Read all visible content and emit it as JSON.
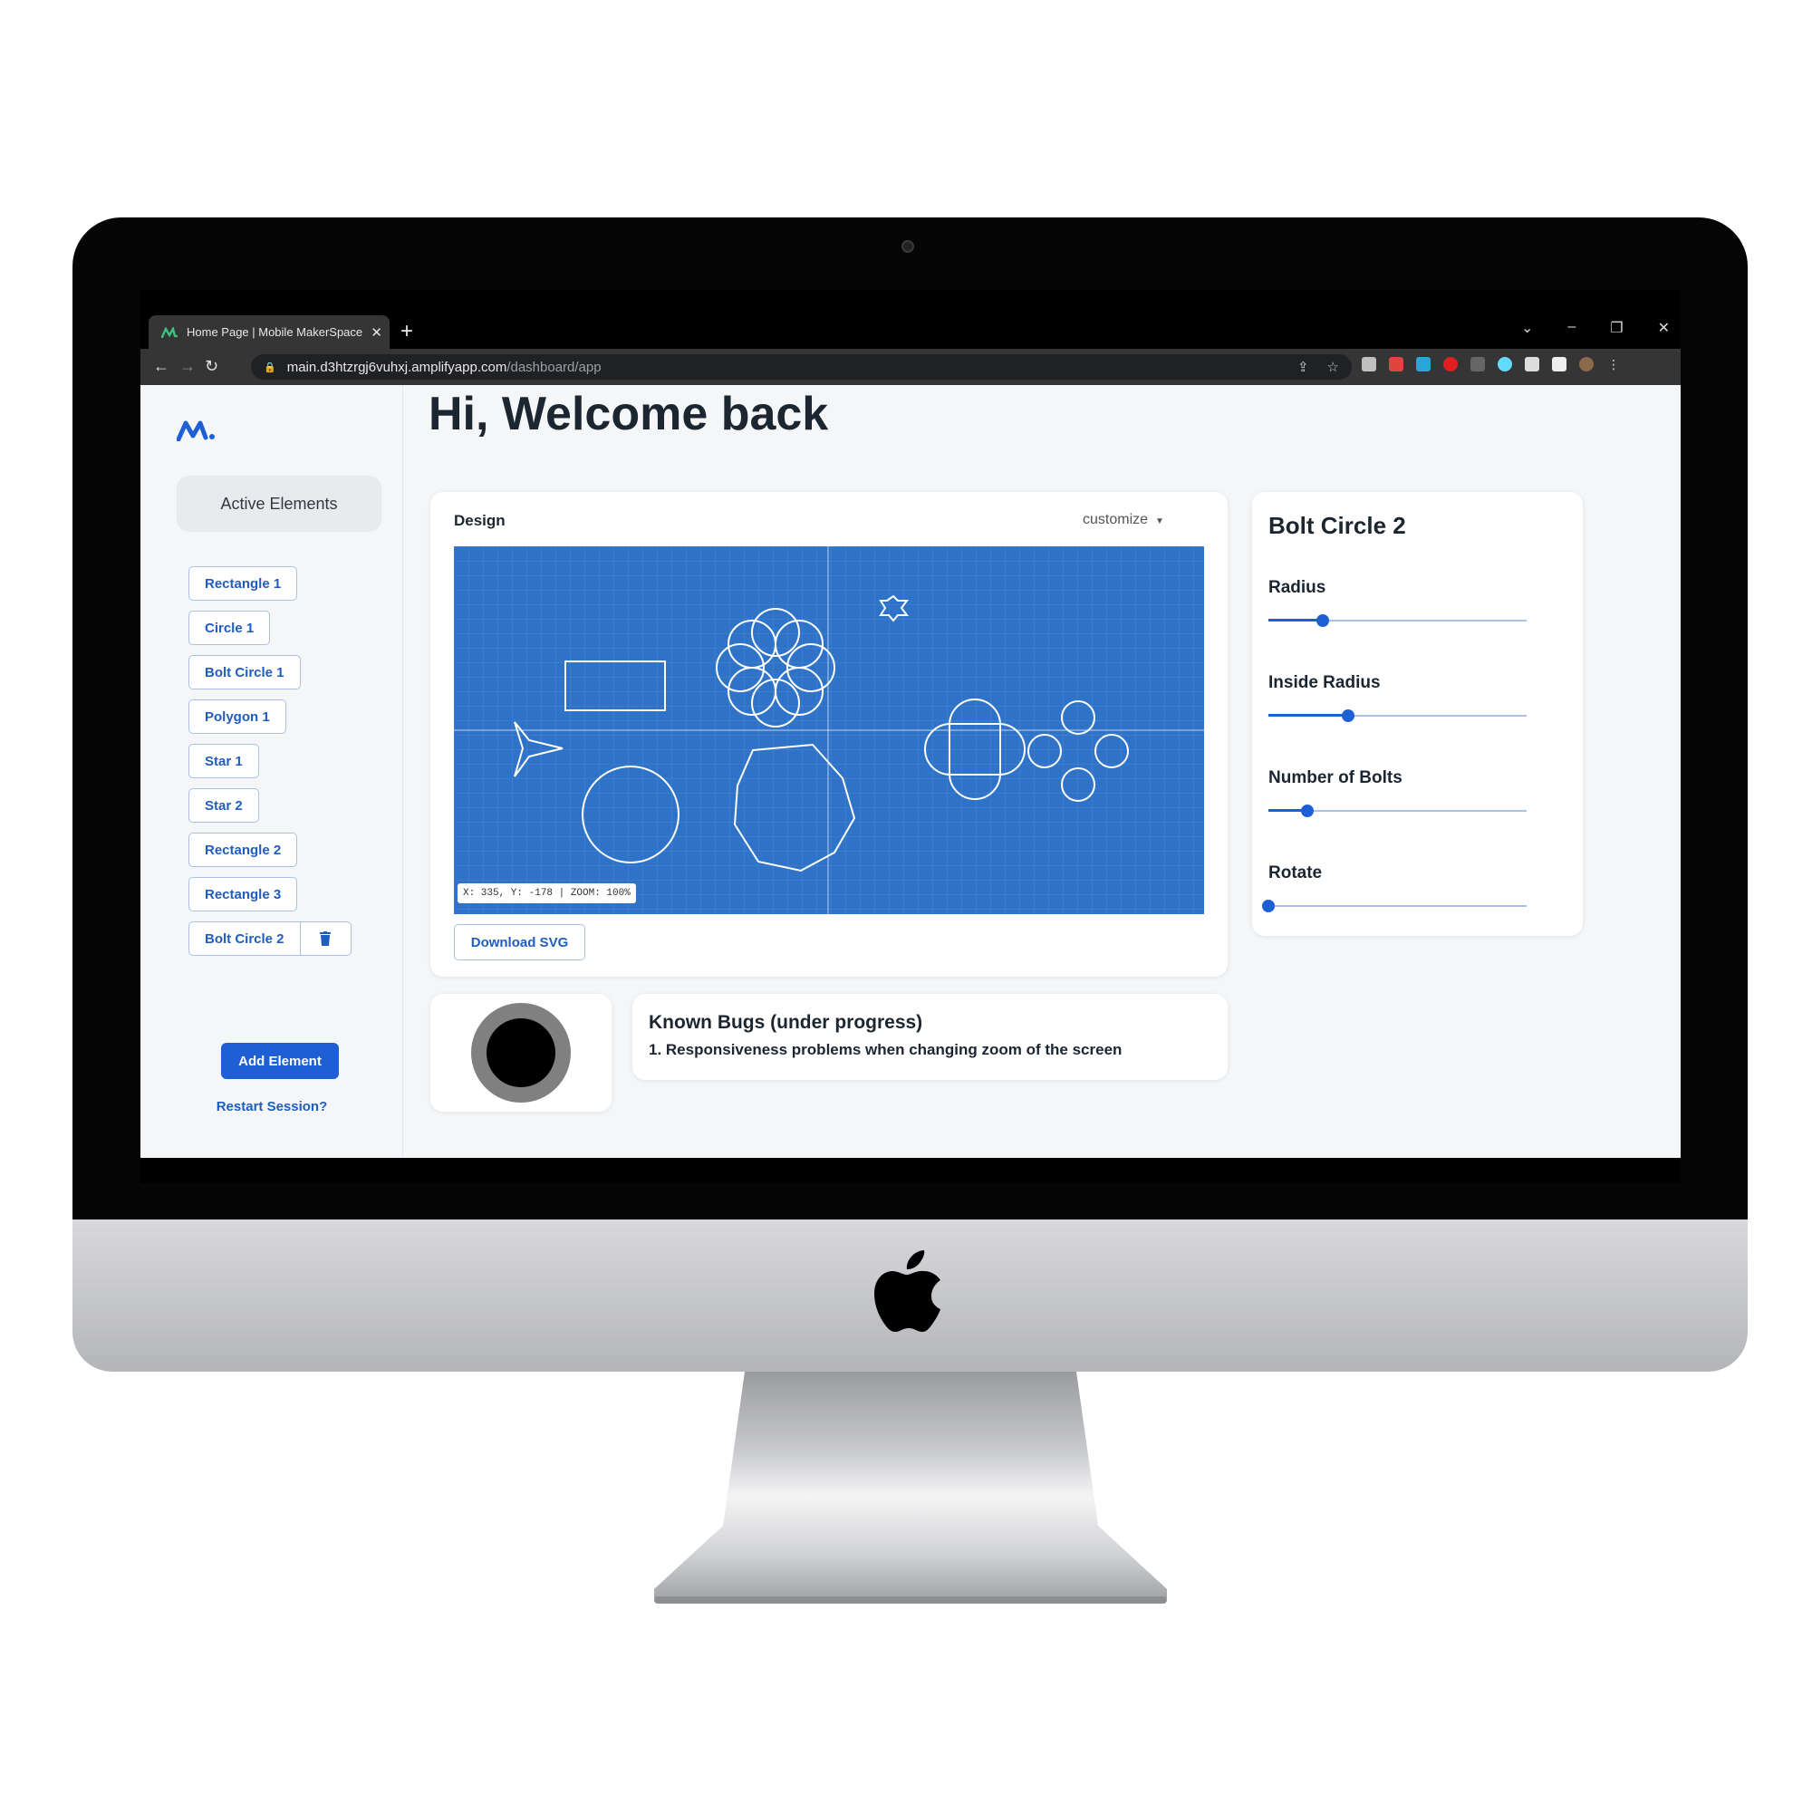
{
  "browser": {
    "tab_title": "Home Page | Mobile MakerSpace",
    "tab_close": "✕",
    "new_tab": "+",
    "url_host": "main.d3htzrgj6vuhxj.amplifyapp.com",
    "url_path": "/dashboard/app"
  },
  "sidebar": {
    "section_title": "Active Elements",
    "elements": [
      "Rectangle 1",
      "Circle 1",
      "Bolt Circle 1",
      "Polygon 1",
      "Star 1",
      "Star 2",
      "Rectangle 2",
      "Rectangle 3",
      "Bolt Circle 2"
    ],
    "add_button": "Add Element",
    "restart_link": "Restart Session?"
  },
  "main": {
    "greeting": "Hi, Welcome back",
    "design": {
      "title": "Design",
      "customize": "customize",
      "coordinates": "X: 335, Y: -178 | ZOOM: 100%",
      "download_button": "Download SVG"
    },
    "properties": {
      "title": "Bolt Circle 2",
      "sliders": [
        {
          "label": "Radius",
          "value": 0.21
        },
        {
          "label": "Inside Radius",
          "value": 0.31
        },
        {
          "label": "Number of Bolts",
          "value": 0.15
        },
        {
          "label": "Rotate",
          "value": 0.0
        }
      ]
    },
    "bugs": {
      "title": "Known Bugs (under progress)",
      "item": "1. Responsiveness problems when changing zoom of the screen"
    }
  },
  "colors": {
    "canvas": "#2f73c8",
    "accent": "#1e5fd6",
    "text": "#1b2631"
  }
}
